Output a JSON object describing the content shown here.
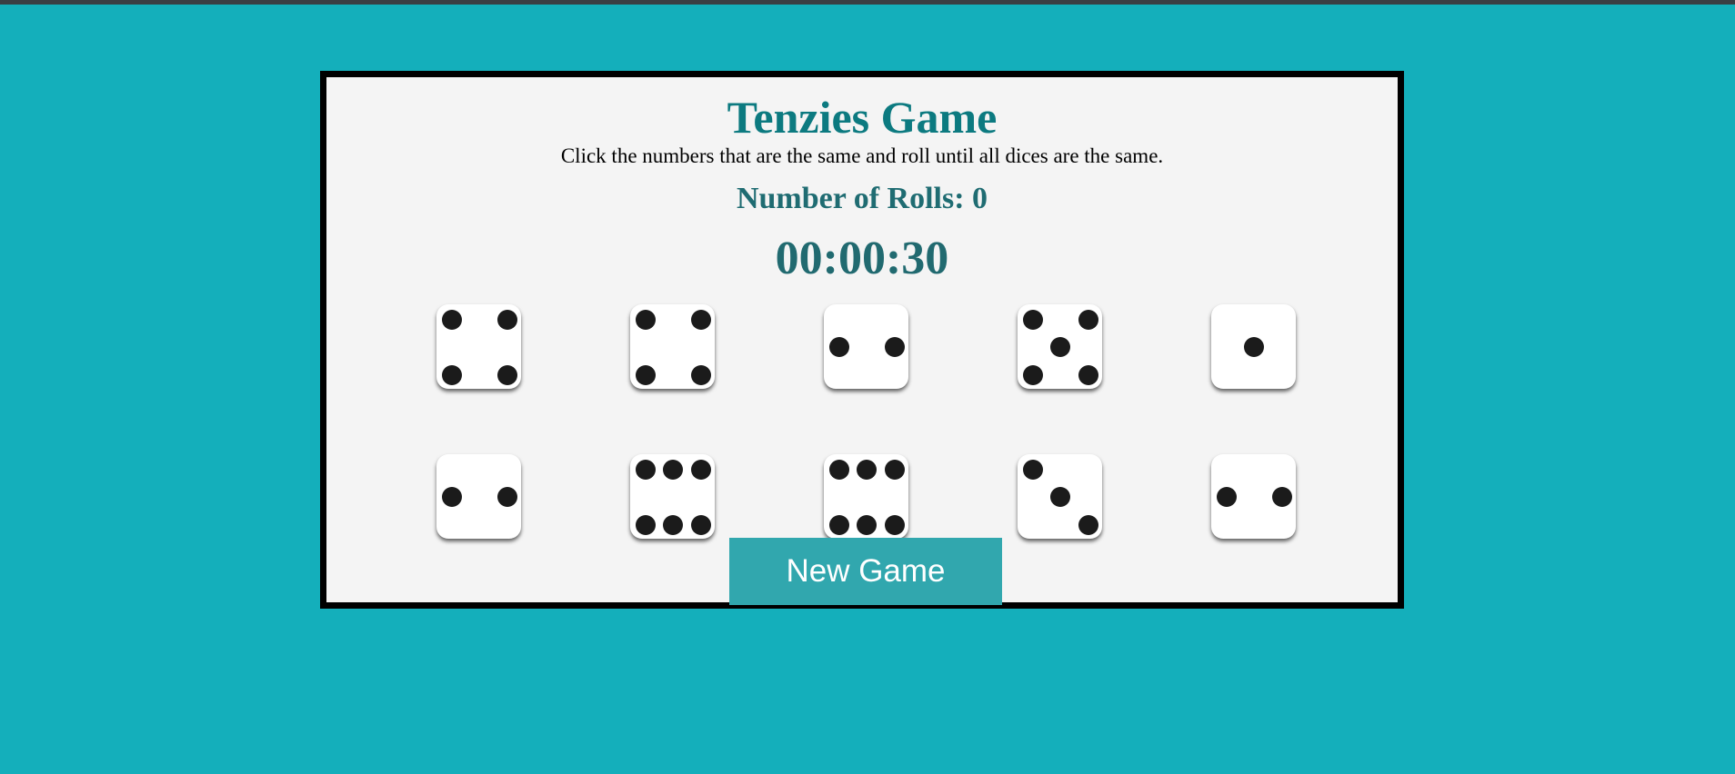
{
  "game": {
    "title": "Tenzies Game",
    "instructions": "Click the numbers that are the same and roll until all dices are the same.",
    "rolls_label": "Number of Rolls:",
    "rolls_count": "0",
    "timer": "00:00:30",
    "new_game_label": "New Game",
    "dice": [
      4,
      4,
      2,
      5,
      1,
      2,
      6,
      6,
      3,
      2
    ]
  },
  "colors": {
    "background": "#14afbb",
    "board": "#f4f4f4",
    "title": "#0c7a80",
    "button": "#31a7ae"
  }
}
